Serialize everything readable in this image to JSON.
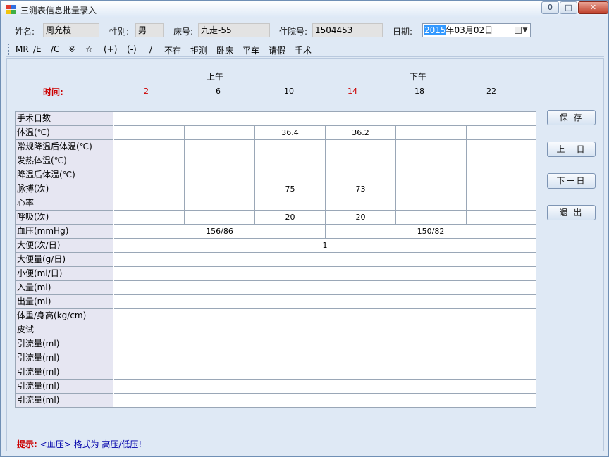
{
  "window": {
    "title": "三测表信息批量录入",
    "minimize": "0",
    "maximize": "□",
    "close": "✕",
    "accent": "#dfe9f5"
  },
  "patient": {
    "name_label": "姓名:",
    "name_value": "周允枝",
    "gender_label": "性别:",
    "gender_value": "男",
    "bed_label": "床号:",
    "bed_value": "九走-55",
    "admission_label": "住院号:",
    "admission_value": "1504453",
    "date_label": "日期:",
    "date_year_selected": "2015",
    "date_rest": "年03月02日"
  },
  "symbols": [
    "MR",
    "/E",
    "/C",
    "※",
    "☆",
    "(+)",
    "(-)",
    "/",
    "不在",
    "拒测",
    "卧床",
    "平车",
    "请假",
    "手术"
  ],
  "header": {
    "morning": "上午",
    "afternoon": "下午",
    "time_label": "时间:",
    "hours": [
      "2",
      "6",
      "10",
      "14",
      "18",
      "22"
    ]
  },
  "rows": [
    {
      "label": "手术日数",
      "kind": "full",
      "value": ""
    },
    {
      "label": "体温(℃)",
      "kind": "six",
      "values": [
        "",
        "",
        "36.4",
        "36.2",
        "",
        ""
      ]
    },
    {
      "label": "常规降温后体温(℃)",
      "kind": "six",
      "values": [
        "",
        "",
        "",
        "",
        "",
        ""
      ]
    },
    {
      "label": "发热体温(℃)",
      "kind": "six",
      "values": [
        "",
        "",
        "",
        "",
        "",
        ""
      ]
    },
    {
      "label": "降温后体温(℃)",
      "kind": "six",
      "values": [
        "",
        "",
        "",
        "",
        "",
        ""
      ]
    },
    {
      "label": "脉搏(次)",
      "kind": "six",
      "values": [
        "",
        "",
        "75",
        "73",
        "",
        ""
      ]
    },
    {
      "label": "心率",
      "kind": "six",
      "values": [
        "",
        "",
        "",
        "",
        "",
        ""
      ]
    },
    {
      "label": "呼吸(次)",
      "kind": "six",
      "values": [
        "",
        "",
        "20",
        "20",
        "",
        ""
      ]
    },
    {
      "label": "血压(mmHg)",
      "kind": "two",
      "values": [
        "156/86",
        "150/82"
      ]
    },
    {
      "label": "大便(次/日)",
      "kind": "full",
      "value": "1"
    },
    {
      "label": "大便量(g/日)",
      "kind": "full",
      "value": ""
    },
    {
      "label": "小便(ml/日)",
      "kind": "full",
      "value": ""
    },
    {
      "label": "入量(ml)",
      "kind": "full",
      "value": ""
    },
    {
      "label": "出量(ml)",
      "kind": "full",
      "value": ""
    },
    {
      "label": "体重/身高(kg/cm)",
      "kind": "full",
      "value": ""
    },
    {
      "label": "皮试",
      "kind": "full",
      "value": ""
    },
    {
      "label": "引流量(ml)",
      "kind": "full",
      "value": ""
    },
    {
      "label": "引流量(ml)",
      "kind": "full",
      "value": ""
    },
    {
      "label": "引流量(ml)",
      "kind": "full",
      "value": ""
    },
    {
      "label": "引流量(ml)",
      "kind": "full",
      "value": ""
    },
    {
      "label": "引流量(ml)",
      "kind": "full",
      "value": ""
    }
  ],
  "buttons": {
    "save": "保 存",
    "prev_day": "上一日",
    "next_day": "下一日",
    "exit": "退 出"
  },
  "hint": {
    "label": "提示:",
    "text": "<血压> 格式为 高压/低压!"
  }
}
